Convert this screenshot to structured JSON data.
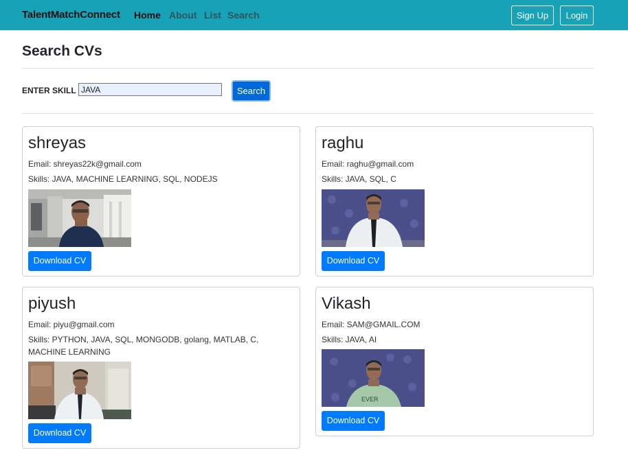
{
  "navbar": {
    "brand": "TalentMatchConnect",
    "links": [
      "Home",
      "About",
      "List",
      "Search"
    ],
    "signup_label": "Sign Up",
    "login_label": "Login"
  },
  "page": {
    "title": "Search CVs",
    "skill_label": "ENTER SKILL",
    "skill_value": "JAVA",
    "search_label": "Search"
  },
  "results": [
    {
      "name": "shreyas",
      "email": "Email: shreyas22k@gmail.com",
      "skills": "Skills: JAVA, MACHINE LEARNING, SQL, NODEJS",
      "download_label": "Download CV"
    },
    {
      "name": "raghu",
      "email": "Email: raghu@gmail.com",
      "skills": "Skills: JAVA, SQL, C",
      "download_label": "Download CV"
    },
    {
      "name": "piyush",
      "email": "Email: piyu@gmail.com",
      "skills": "Skills: PYTHON, JAVA, SQL, MONGODB, golang, MATLAB, C, MACHINE LEARNING",
      "download_label": "Download CV"
    },
    {
      "name": "Vikash",
      "email": "Email: SAM@GMAIL.COM",
      "skills": "Skills: JAVA, AI",
      "download_label": "Download CV"
    }
  ],
  "colors": {
    "navbar": "#17a2b8",
    "primary_button": "#007bff",
    "search_button": "#0069d9"
  }
}
